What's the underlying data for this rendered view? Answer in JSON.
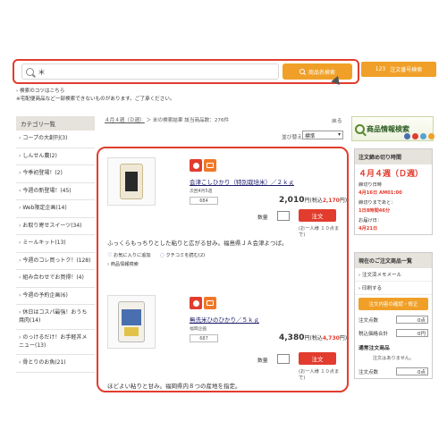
{
  "search": {
    "value": "＊",
    "button_label": "商品名検索",
    "order_number_label": "注文番号検索",
    "order_number_prefix": "123"
  },
  "tips": {
    "line1": "検索のコツはこちら",
    "line2": "※宅配便商品など一部検索できないものがあります。ご了承ください。"
  },
  "sidebar": {
    "heading": "カテゴリ一覧",
    "items": [
      {
        "label": "コープの大創刊(3)"
      },
      {
        "label": "しんせん農(2)"
      },
      {
        "label": "今季初登場！(2)"
      },
      {
        "label": "今週の新登場！(45)"
      },
      {
        "label": "Web限定企画(14)"
      },
      {
        "label": "お取り寄せスイーツ(34)"
      },
      {
        "label": "ミールキット(13)"
      },
      {
        "label": "今週のコレ買っトク！(128)"
      },
      {
        "label": "組み合わせでお買得！(4)"
      },
      {
        "label": "今週の予約企画(6)"
      },
      {
        "label": "休日はコスパ最強！おうち焼肉(14)"
      },
      {
        "label": "のっけるだけ！お手軽丼メニュー(13)"
      },
      {
        "label": "骨とりのお魚(21)"
      }
    ]
  },
  "breadcrumb": {
    "week_link": "４月４週（Ｄ週）",
    "rest": "＞ 米の検索結果 該当商品数：276件"
  },
  "back_label": "戻る",
  "sort": {
    "label": "並び替え",
    "selected": "標準"
  },
  "products": [
    {
      "name": "会津こしひかり（特別栽培米）／２ｋｇ",
      "origin": "次回4月5週",
      "code": "684",
      "price": "2,010",
      "price_suffix": "円(税込",
      "tax_price": "2,170",
      "tax_suffix": "円)",
      "qty_label": "数量",
      "order_label": "注文",
      "limit": "(お一人様 １０点まで)",
      "description": "ふっくらもっちりとした粘りと広がる甘み。福島県ＪＡ会津よつば。",
      "favorite_label": "お気に入りに追加",
      "review_label": "クチコミを読む",
      "review_count": "(2)",
      "detail_label": "商品情報検索"
    },
    {
      "name": "無洗米ひのひかり／５ｋｇ",
      "origin": "福岡企画",
      "code": "687",
      "price": "4,380",
      "price_suffix": "円(税込",
      "tax_price": "4,730",
      "tax_suffix": "円)",
      "qty_label": "数量",
      "order_label": "注文",
      "limit": "(お一人様 １０点まで)",
      "description": "ほどよい粘りと甘み。福岡県内８つの産地を指定。"
    }
  ],
  "right": {
    "banner": "商品情報検索",
    "deadline_heading": "注文締め切り時間",
    "deadline_week": "４月４週（Ｄ週）",
    "deadline_label": "締切り日時",
    "deadline_value": "4月16日 AM01:00",
    "remaining_label": "締切りまであと：",
    "remaining_value": "1日8時間46分",
    "delivery_label": "お届け日：",
    "delivery_value": "4月21日",
    "current_heading": "現在のご注文商品一覧",
    "memo_link": "注文済メモメール",
    "print_link": "印刷する",
    "confirm_button": "注文内容の確認・修正",
    "qty_total_label": "注文点数",
    "qty_total_value": "0点",
    "amount_label": "税込価格合計",
    "amount_value": "0円",
    "regular_heading": "通常注文商品",
    "regular_note": "注文はありません。",
    "regular_qty_label": "注文点数",
    "regular_qty_value": "0点",
    "colors": {
      "accent": "#e23c2e",
      "orange": "#f0a028"
    }
  }
}
